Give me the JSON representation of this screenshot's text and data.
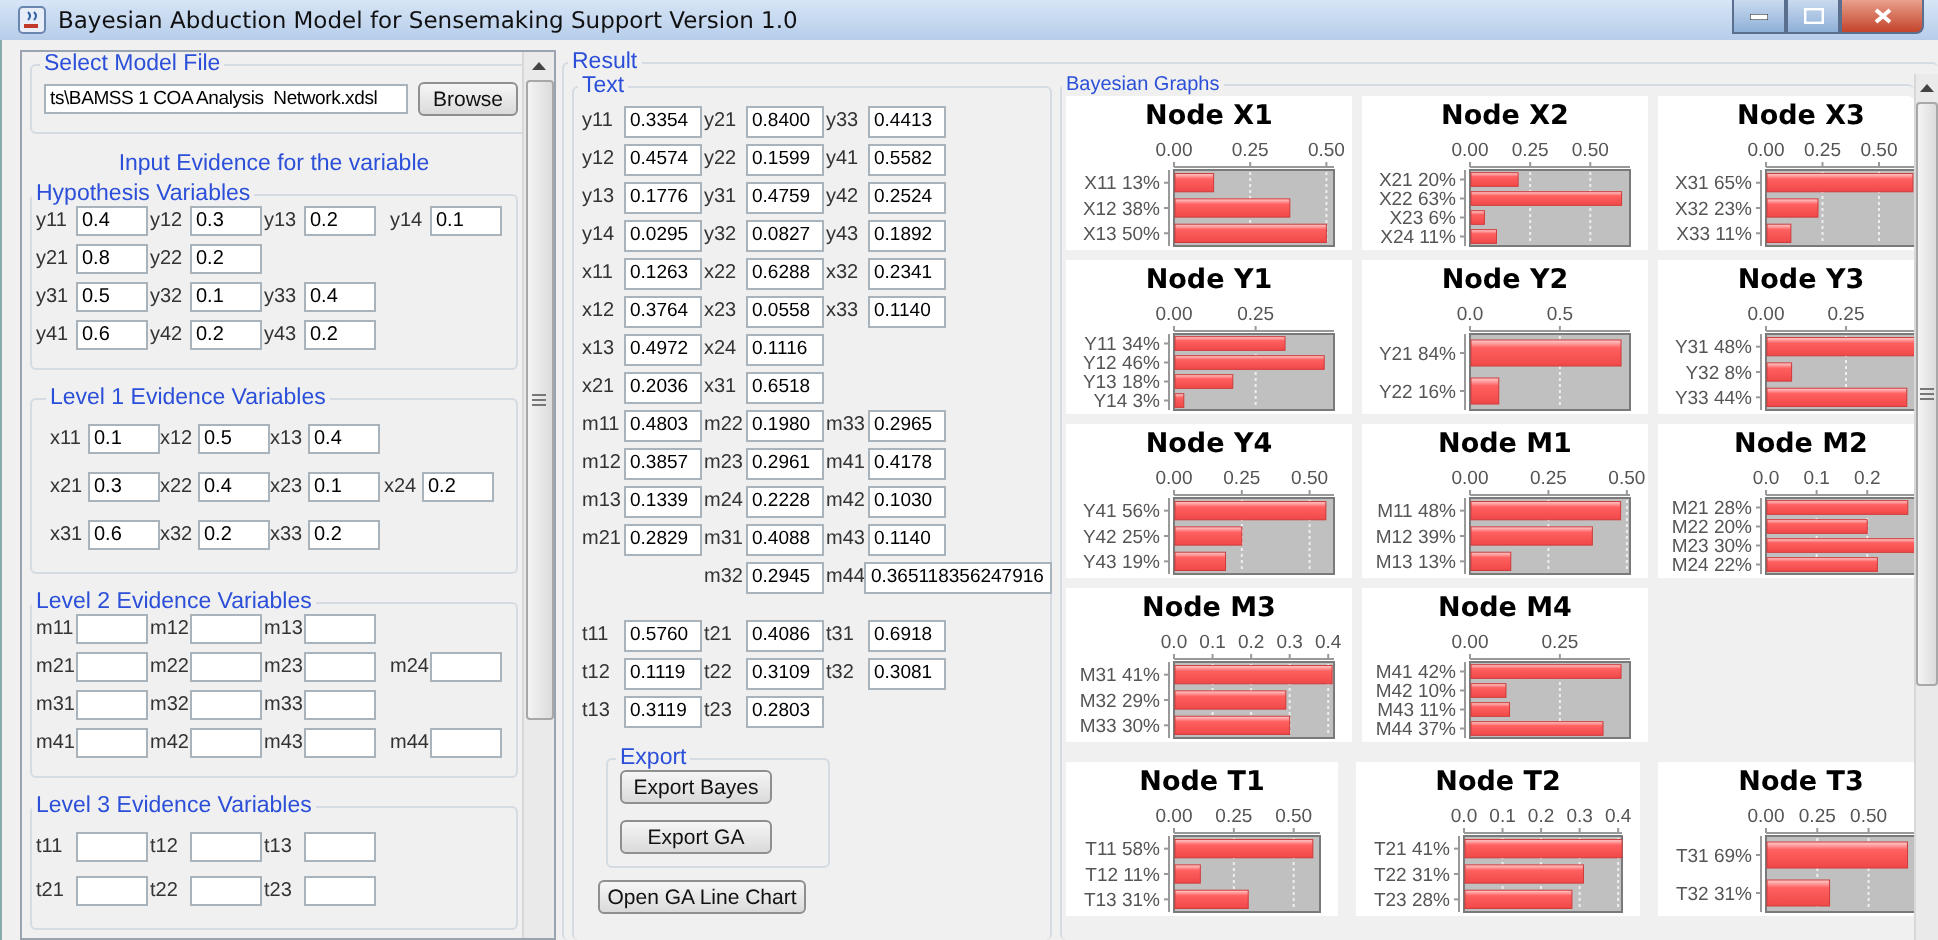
{
  "window": {
    "title": "Bayesian Abduction Model for Sensemaking Support Version 1.0"
  },
  "model_file": {
    "title": "Select Model File",
    "path": "ts\\BAMSS 1 COA Analysis  Network.xdsl",
    "button": "Browse"
  },
  "evidence_heading": "Input Evidence for the variable",
  "evidence_groups": [
    {
      "title": "Hypothesis Variables",
      "rows": [
        [
          {
            "label": "y11",
            "value": "0.4"
          },
          {
            "label": "y12",
            "value": "0.3"
          },
          {
            "label": "y13",
            "value": "0.2"
          },
          {
            "label": "y14",
            "value": "0.1"
          }
        ],
        [
          {
            "label": "y21",
            "value": "0.8"
          },
          {
            "label": "y22",
            "value": "0.2"
          }
        ],
        [
          {
            "label": "y31",
            "value": "0.5"
          },
          {
            "label": "y32",
            "value": "0.1"
          },
          {
            "label": "y33",
            "value": "0.4"
          }
        ],
        [
          {
            "label": "y41",
            "value": "0.6"
          },
          {
            "label": "y42",
            "value": "0.2"
          },
          {
            "label": "y43",
            "value": "0.2"
          }
        ]
      ]
    },
    {
      "title": "Level 1 Evidence Variables",
      "rows": [
        [
          {
            "label": "x11",
            "value": "0.1"
          },
          {
            "label": "x12",
            "value": "0.5"
          },
          {
            "label": "x13",
            "value": "0.4"
          }
        ],
        [
          {
            "label": "x21",
            "value": "0.3"
          },
          {
            "label": "x22",
            "value": "0.4"
          },
          {
            "label": "x23",
            "value": "0.1"
          },
          {
            "label": "x24",
            "value": "0.2"
          }
        ],
        [
          {
            "label": "x31",
            "value": "0.6"
          },
          {
            "label": "x32",
            "value": "0.2"
          },
          {
            "label": "x33",
            "value": "0.2"
          }
        ]
      ]
    },
    {
      "title": "Level 2 Evidence Variables",
      "rows": [
        [
          {
            "label": "m11"
          },
          {
            "label": "m12"
          },
          {
            "label": "m13"
          }
        ],
        [
          {
            "label": "m21"
          },
          {
            "label": "m22"
          },
          {
            "label": "m23"
          },
          {
            "label": "m24"
          }
        ],
        [
          {
            "label": "m31"
          },
          {
            "label": "m32"
          },
          {
            "label": "m33"
          }
        ],
        [
          {
            "label": "m41"
          },
          {
            "label": "m42"
          },
          {
            "label": "m43"
          },
          {
            "label": "m44"
          }
        ]
      ]
    },
    {
      "title": "Level 3 Evidence Variables",
      "rows": [
        [
          {
            "label": "t11"
          },
          {
            "label": "t12"
          },
          {
            "label": "t13"
          }
        ],
        [
          {
            "label": "t21"
          },
          {
            "label": "t22"
          },
          {
            "label": "t23"
          }
        ]
      ]
    }
  ],
  "result": {
    "title": "Result",
    "text_panel": {
      "title": "Text",
      "sections": [
        {
          "rows": [
            [
              {
                "label": "y11",
                "value": "0.3354"
              },
              {
                "label": "y21",
                "value": "0.8400"
              },
              {
                "label": "y33",
                "value": "0.4413"
              }
            ],
            [
              {
                "label": "y12",
                "value": "0.4574"
              },
              {
                "label": "y22",
                "value": "0.1599"
              },
              {
                "label": "y41",
                "value": "0.5582"
              }
            ],
            [
              {
                "label": "y13",
                "value": "0.1776"
              },
              {
                "label": "y31",
                "value": "0.4759"
              },
              {
                "label": "y42",
                "value": "0.2524"
              }
            ],
            [
              {
                "label": "y14",
                "value": "0.0295"
              },
              {
                "label": "y32",
                "value": "0.0827"
              },
              {
                "label": "y43",
                "value": "0.1892"
              }
            ]
          ]
        },
        {
          "rows": [
            [
              {
                "label": "x11",
                "value": "0.1263"
              },
              {
                "label": "x22",
                "value": "0.6288"
              },
              {
                "label": "x32",
                "value": "0.2341"
              }
            ],
            [
              {
                "label": "x12",
                "value": "0.3764"
              },
              {
                "label": "x23",
                "value": "0.0558"
              },
              {
                "label": "x33",
                "value": "0.1140"
              }
            ],
            [
              {
                "label": "x13",
                "value": "0.4972"
              },
              {
                "label": "x24",
                "value": "0.1116"
              }
            ],
            [
              {
                "label": "x21",
                "value": "0.2036"
              },
              {
                "label": "x31",
                "value": "0.6518"
              }
            ]
          ]
        },
        {
          "rows": [
            [
              {
                "label": "m11",
                "value": "0.4803"
              },
              {
                "label": "m22",
                "value": "0.1980"
              },
              {
                "label": "m33",
                "value": "0.2965"
              }
            ],
            [
              {
                "label": "m12",
                "value": "0.3857"
              },
              {
                "label": "m23",
                "value": "0.2961"
              },
              {
                "label": "m41",
                "value": "0.4178"
              }
            ],
            [
              {
                "label": "m13",
                "value": "0.1339"
              },
              {
                "label": "m24",
                "value": "0.2228"
              },
              {
                "label": "m42",
                "value": "0.1030"
              }
            ],
            [
              {
                "label": "m21",
                "value": "0.2829"
              },
              {
                "label": "m31",
                "value": "0.4088"
              },
              {
                "label": "m43",
                "value": "0.1140"
              }
            ],
            [
              null,
              {
                "label": "m32",
                "value": "0.2945"
              },
              {
                "label": "m44",
                "value": "0.365118356247916",
                "kind": "wide"
              }
            ]
          ]
        },
        {
          "rows": [
            [
              {
                "label": "t11",
                "value": "0.5760"
              },
              {
                "label": "t21",
                "value": "0.4086"
              },
              {
                "label": "t31",
                "value": "0.6918"
              }
            ],
            [
              {
                "label": "t12",
                "value": "0.1119"
              },
              {
                "label": "t22",
                "value": "0.3109"
              },
              {
                "label": "t32",
                "value": "0.3081"
              }
            ],
            [
              {
                "label": "t13",
                "value": "0.3119"
              },
              {
                "label": "t23",
                "value": "0.2803"
              }
            ]
          ]
        }
      ]
    },
    "export": {
      "title": "Export",
      "buttons": [
        "Export Bayes",
        "Export GA"
      ]
    },
    "line_chart_button": "Open GA Line Chart",
    "graphs": {
      "title": "Bayesian Graphs",
      "nodes": [
        {
          "chart_data": {
            "type": "bar",
            "orientation": "horizontal",
            "title": "Node X1",
            "grid": true,
            "categories": [
              "X11 13%",
              "X12 38%",
              "X13 50%"
            ],
            "values": [
              0.13,
              0.38,
              0.5
            ],
            "xlim": [
              0,
              0.525
            ],
            "xticks": [
              {
                "value": 0,
                "label": "0.00"
              },
              {
                "value": 0.25,
                "label": "0.25"
              },
              {
                "value": 0.5,
                "label": "0.50"
              }
            ]
          }
        },
        {
          "chart_data": {
            "type": "bar",
            "orientation": "horizontal",
            "title": "Node X2",
            "grid": true,
            "categories": [
              "X21 20%",
              "X22 63%",
              "X23 6%",
              "X24 11%"
            ],
            "values": [
              0.2,
              0.63,
              0.06,
              0.11
            ],
            "xlim": [
              0,
              0.665
            ],
            "xticks": [
              {
                "value": 0,
                "label": "0.00"
              },
              {
                "value": 0.25,
                "label": "0.25"
              },
              {
                "value": 0.5,
                "label": "0.50"
              }
            ]
          }
        },
        {
          "chart_data": {
            "type": "bar",
            "orientation": "horizontal",
            "title": "Node X3",
            "grid": true,
            "categories": [
              "X31 65%",
              "X32 23%",
              "X33 11%"
            ],
            "values": [
              0.65,
              0.23,
              0.11
            ],
            "xlim": [
              0,
              0.708
            ],
            "xticks": [
              {
                "value": 0,
                "label": "0.00"
              },
              {
                "value": 0.25,
                "label": "0.25"
              },
              {
                "value": 0.5,
                "label": "0.50"
              }
            ]
          }
        },
        {
          "chart_data": {
            "type": "bar",
            "orientation": "horizontal",
            "title": "Node Y1",
            "grid": true,
            "categories": [
              "Y11 34%",
              "Y12 46%",
              "Y13 18%",
              "Y14 3%"
            ],
            "values": [
              0.34,
              0.46,
              0.18,
              0.03
            ],
            "xlim": [
              0,
              0.49
            ],
            "xticks": [
              {
                "value": 0,
                "label": "0.00"
              },
              {
                "value": 0.25,
                "label": "0.25"
              }
            ]
          }
        },
        {
          "chart_data": {
            "type": "bar",
            "orientation": "horizontal",
            "title": "Node Y2",
            "grid": true,
            "categories": [
              "Y21 84%",
              "Y22 16%"
            ],
            "values": [
              0.84,
              0.16
            ],
            "xlim": [
              0,
              0.89
            ],
            "xticks": [
              {
                "value": 0,
                "label": "0.0"
              },
              {
                "value": 0.5,
                "label": "0.5"
              }
            ]
          }
        },
        {
          "chart_data": {
            "type": "bar",
            "orientation": "horizontal",
            "title": "Node Y3",
            "grid": true,
            "categories": [
              "Y31 48%",
              "Y32 8%",
              "Y33 44%"
            ],
            "values": [
              0.48,
              0.08,
              0.44
            ],
            "xlim": [
              0,
              0.5
            ],
            "xticks": [
              {
                "value": 0,
                "label": "0.00"
              },
              {
                "value": 0.25,
                "label": "0.25"
              }
            ]
          }
        },
        {
          "chart_data": {
            "type": "bar",
            "orientation": "horizontal",
            "title": "Node Y4",
            "grid": true,
            "categories": [
              "Y41 56%",
              "Y42 25%",
              "Y43 19%"
            ],
            "values": [
              0.56,
              0.25,
              0.19
            ],
            "xlim": [
              0,
              0.59
            ],
            "xticks": [
              {
                "value": 0,
                "label": "0.00"
              },
              {
                "value": 0.25,
                "label": "0.25"
              },
              {
                "value": 0.5,
                "label": "0.50"
              }
            ]
          }
        },
        {
          "chart_data": {
            "type": "bar",
            "orientation": "horizontal",
            "title": "Node M1",
            "grid": true,
            "categories": [
              "M11 48%",
              "M12 39%",
              "M13 13%"
            ],
            "values": [
              0.48,
              0.39,
              0.13
            ],
            "xlim": [
              0,
              0.51
            ],
            "xticks": [
              {
                "value": 0,
                "label": "0.00"
              },
              {
                "value": 0.25,
                "label": "0.25"
              },
              {
                "value": 0.5,
                "label": "0.50"
              }
            ]
          }
        },
        {
          "chart_data": {
            "type": "bar",
            "orientation": "horizontal",
            "title": "Node M2",
            "grid": true,
            "categories": [
              "M21 28%",
              "M22 20%",
              "M23 30%",
              "M24 22%"
            ],
            "values": [
              0.28,
              0.2,
              0.3,
              0.22
            ],
            "xlim": [
              0,
              0.316
            ],
            "xticks": [
              {
                "value": 0,
                "label": "0.0"
              },
              {
                "value": 0.1,
                "label": "0.1"
              },
              {
                "value": 0.2,
                "label": "0.2"
              }
            ]
          }
        },
        {
          "chart_data": {
            "type": "bar",
            "orientation": "horizontal",
            "title": "Node M3",
            "grid": true,
            "categories": [
              "M31 41%",
              "M32 29%",
              "M33 30%"
            ],
            "values": [
              0.41,
              0.29,
              0.3
            ],
            "xlim": [
              0,
              0.415
            ],
            "xticks": [
              {
                "value": 0,
                "label": "0.0"
              },
              {
                "value": 0.1,
                "label": "0.1"
              },
              {
                "value": 0.2,
                "label": "0.2"
              },
              {
                "value": 0.3,
                "label": "0.3"
              },
              {
                "value": 0.4,
                "label": "0.4"
              }
            ]
          }
        },
        {
          "chart_data": {
            "type": "bar",
            "orientation": "horizontal",
            "title": "Node M4",
            "grid": true,
            "categories": [
              "M41 42%",
              "M42 10%",
              "M43 11%",
              "M44 37%"
            ],
            "values": [
              0.42,
              0.1,
              0.11,
              0.37
            ],
            "xlim": [
              0,
              0.445
            ],
            "xticks": [
              {
                "value": 0,
                "label": "0.00"
              },
              {
                "value": 0.25,
                "label": "0.25"
              }
            ]
          }
        }
      ],
      "level3_nodes": [
        {
          "chart_data": {
            "type": "bar",
            "orientation": "horizontal",
            "title": "Node T1",
            "grid": true,
            "categories": [
              "T11 58%",
              "T12 11%",
              "T13 31%"
            ],
            "values": [
              0.58,
              0.11,
              0.31
            ],
            "xlim": [
              0,
              0.61
            ],
            "xticks": [
              {
                "value": 0,
                "label": "0.00"
              },
              {
                "value": 0.25,
                "label": "0.25"
              },
              {
                "value": 0.5,
                "label": "0.50"
              }
            ]
          }
        },
        {
          "chart_data": {
            "type": "bar",
            "orientation": "horizontal",
            "title": "Node T2",
            "grid": true,
            "categories": [
              "T21 41%",
              "T22 31%",
              "T23 28%"
            ],
            "values": [
              0.41,
              0.31,
              0.28
            ],
            "xlim": [
              0,
              0.41
            ],
            "xticks": [
              {
                "value": 0,
                "label": "0.0"
              },
              {
                "value": 0.1,
                "label": "0.1"
              },
              {
                "value": 0.2,
                "label": "0.2"
              },
              {
                "value": 0.3,
                "label": "0.3"
              },
              {
                "value": 0.4,
                "label": "0.4"
              }
            ]
          }
        },
        {
          "chart_data": {
            "type": "bar",
            "orientation": "horizontal",
            "title": "Node T3",
            "grid": true,
            "categories": [
              "T31 69%",
              "T32 31%"
            ],
            "values": [
              0.69,
              0.31
            ],
            "xlim": [
              0,
              0.78
            ],
            "xticks": [
              {
                "value": 0,
                "label": "0.00"
              },
              {
                "value": 0.25,
                "label": "0.25"
              },
              {
                "value": 0.5,
                "label": "0.50"
              }
            ]
          }
        }
      ]
    }
  }
}
